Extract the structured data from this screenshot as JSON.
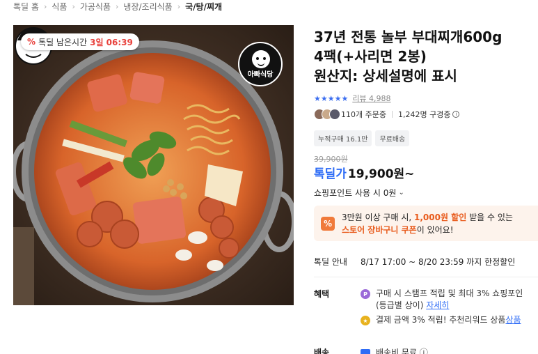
{
  "breadcrumb": [
    "톡딜 홈",
    "식품",
    "가공식품",
    "냉장/조리식품",
    "국/탕/찌개"
  ],
  "image": {
    "timer_pct_icon": "%",
    "timer_label": "톡딜 남은시간",
    "timer_value": "3일 06:39",
    "brand_logo_text": "아빠식당"
  },
  "product": {
    "title_line1": "37년 전통 놀부 부대찌개600g",
    "title_line2": "4팩(+사리면 2봉)",
    "title_line3": "원산지: 상세설명에 표시",
    "rating_stars": "★★★★★",
    "rating": 4.5,
    "reviews_label": "리뷰 4,988",
    "orders": "110개 주문중",
    "viewers": "1,242명 구경중",
    "tags": [
      "누적구매 16.1만",
      "무료배송"
    ],
    "original_price": "39,900원",
    "deal_label": "톡딜가",
    "deal_price": "19,900원~",
    "points_label": "쇼핑포인트 사용 시 0원"
  },
  "coupon": {
    "icon": "%",
    "line1_pre": "3만원 이상 구매 시, ",
    "line1_hl": "1,000원 할인",
    "line1_post": " 받을 수 있는",
    "line2_link": "스토어 장바구니 쿠폰",
    "line2_post": "이 있어요!"
  },
  "deal_info": {
    "label": "톡딜 안내",
    "value": "8/17 17:00 ~ 8/20 23:59 까지 한정할인"
  },
  "benefit": {
    "label": "혜택",
    "row1_line1": "구매 시 스탬프 적립 및 최대 3% 쇼핑포인",
    "row1_line2_pre": "(등급별 상이) ",
    "row1_link": "자세히",
    "row2_text": "결제 금액 3% 적립! 추천리워드 상품 ",
    "row2_link": "상품"
  },
  "shipping": {
    "label": "배송",
    "value": "배송비 무료 ⓘ"
  },
  "colors": {
    "accent_blue": "#2e6cf6",
    "deal_red": "#e8403b",
    "coupon_orange": "#e85a1b",
    "coupon_bg": "#fdf3ec"
  }
}
